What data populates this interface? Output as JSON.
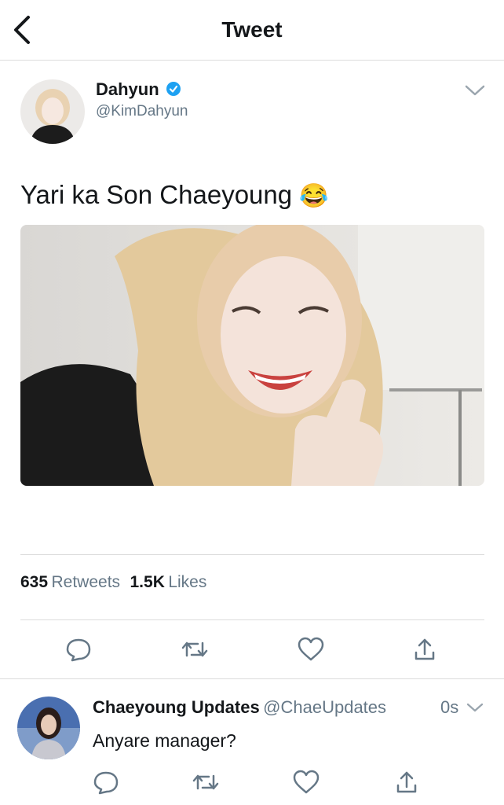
{
  "header": {
    "title": "Tweet"
  },
  "tweet": {
    "author_name": "Dahyun",
    "author_handle": "@KimDahyun",
    "text": "Yari ka Son Chaeyoung",
    "emoji": "😂",
    "stats": {
      "retweet_count": "635",
      "retweet_label": "Retweets",
      "like_count": "1.5K",
      "like_label": "Likes"
    }
  },
  "reply": {
    "author_name": "Chaeyoung Updates",
    "author_handle": "@ChaeUpdates",
    "time": "0s",
    "text": "Anyare manager?"
  },
  "icons": {
    "back": "back-arrow-icon",
    "verified": "verified-badge-icon",
    "menu": "chevron-down-icon",
    "reply": "reply-icon",
    "retweet": "retweet-icon",
    "like": "heart-icon",
    "share": "share-icon"
  },
  "colors": {
    "accent": "#1da1f2",
    "muted": "#657786",
    "divider": "#dcdcdc",
    "text": "#14171a"
  }
}
